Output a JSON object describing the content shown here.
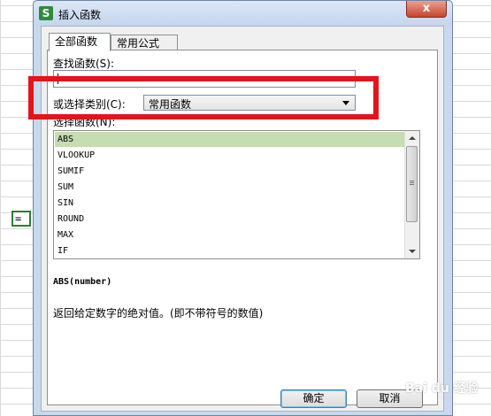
{
  "sheet": {
    "cell_value": "="
  },
  "dialog": {
    "title": "插入函数",
    "app_icon_letter": "S",
    "close_label": "x",
    "tabs": [
      {
        "label": "全部函数"
      },
      {
        "label": "常用公式"
      }
    ],
    "search_label": "查找函数(S):",
    "search_value": "",
    "category_label": "或选择类别(C):",
    "category_value": "常用函数",
    "functions_label": "选择函数(N):",
    "functions": [
      "ABS",
      "VLOOKUP",
      "SUMIF",
      "SUM",
      "SIN",
      "ROUND",
      "MAX",
      "IF"
    ],
    "selected_function": "ABS",
    "signature": "ABS(number)",
    "description": "返回给定数字的绝对值。(即不带符号的数值)",
    "ok_label": "确定",
    "cancel_label": "取消"
  },
  "overlay": {
    "highlight_color": "#e4141c",
    "watermark": "Bai du 经验"
  }
}
